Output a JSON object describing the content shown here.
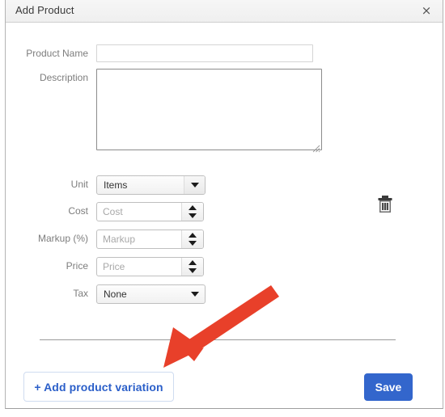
{
  "window": {
    "title": "Add Product",
    "close_icon": "close-icon",
    "close_glyph": "×"
  },
  "form": {
    "product_name": {
      "label": "Product Name",
      "value": "",
      "placeholder": ""
    },
    "description": {
      "label": "Description",
      "value": "",
      "placeholder": ""
    },
    "unit": {
      "label": "Unit",
      "value": "Items",
      "options": [
        "Items"
      ]
    },
    "cost": {
      "label": "Cost",
      "value": "",
      "placeholder": "Cost"
    },
    "markup": {
      "label": "Markup (%)",
      "value": "",
      "placeholder": "Markup"
    },
    "price": {
      "label": "Price",
      "value": "",
      "placeholder": "Price"
    },
    "tax": {
      "label": "Tax",
      "value": "None",
      "options": [
        "None"
      ]
    },
    "delete_icon": "trash-icon"
  },
  "footer": {
    "add_variation_label": "+ Add product variation",
    "save_label": "Save"
  },
  "annotation": {
    "arrow_color": "#e8402a",
    "points_to": "add-variation-button"
  },
  "colors": {
    "accent_blue": "#3366cc",
    "link_blue": "#2b5fc9",
    "annotation_red": "#e8402a",
    "label_gray": "#7d7d7d",
    "titlebar": "#f2f2f2"
  }
}
